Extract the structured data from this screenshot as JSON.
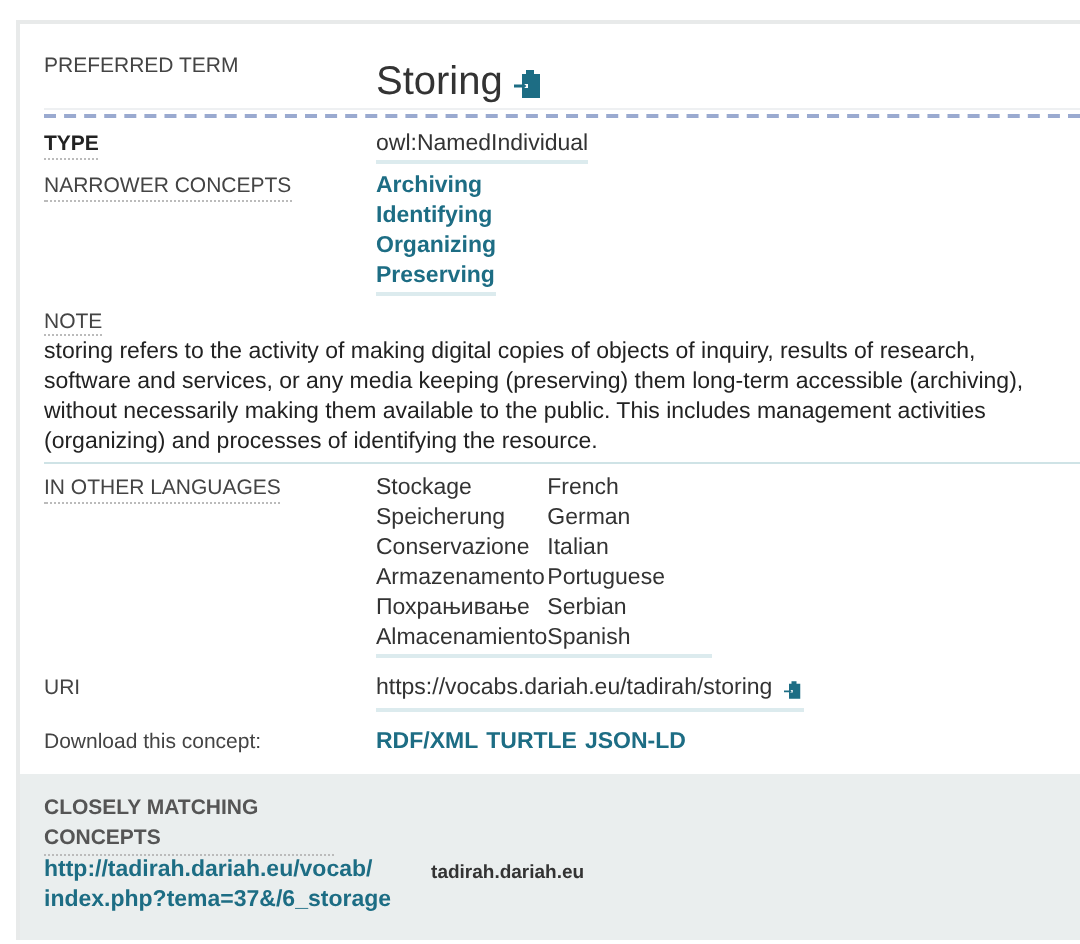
{
  "preferred_term": {
    "label": "PREFERRED TERM",
    "value": "Storing"
  },
  "type": {
    "label": "TYPE",
    "value": "owl:NamedIndividual"
  },
  "narrower_concepts": {
    "label": "NARROWER CONCEPTS",
    "items": [
      "Archiving",
      "Identifying",
      "Organizing",
      "Preserving"
    ]
  },
  "note": {
    "label": "NOTE",
    "text": "storing refers to the activity of making digital copies of objects of inquiry, results of research, software and services, or any media keeping (preserving) them long-term accessible (archiving), without necessarily making them available to the public. This includes management activities (organizing) and processes of identifying the resource."
  },
  "other_languages": {
    "label": "IN OTHER LANGUAGES",
    "items": [
      {
        "term": "Stockage",
        "language": "French"
      },
      {
        "term": "Speicherung",
        "language": "German"
      },
      {
        "term": "Conservazione",
        "language": "Italian"
      },
      {
        "term": "Armazenamento",
        "language": "Portuguese"
      },
      {
        "term": "Похрањивање",
        "language": "Serbian"
      },
      {
        "term": "Almacenamiento",
        "language": "Spanish"
      }
    ]
  },
  "uri": {
    "label": "URI",
    "value": "https://vocabs.dariah.eu/tadirah/storing"
  },
  "download": {
    "label": "Download this concept:",
    "formats": [
      "RDF/XML",
      "TURTLE",
      "JSON-LD"
    ]
  },
  "closely_matching": {
    "label": "CLOSELY MATCHING CONCEPTS",
    "link_lines": [
      "http://tadirah.dariah.eu/vocab/",
      "index.php?tema=37&/6_storage"
    ],
    "source": "tadirah.dariah.eu"
  }
}
